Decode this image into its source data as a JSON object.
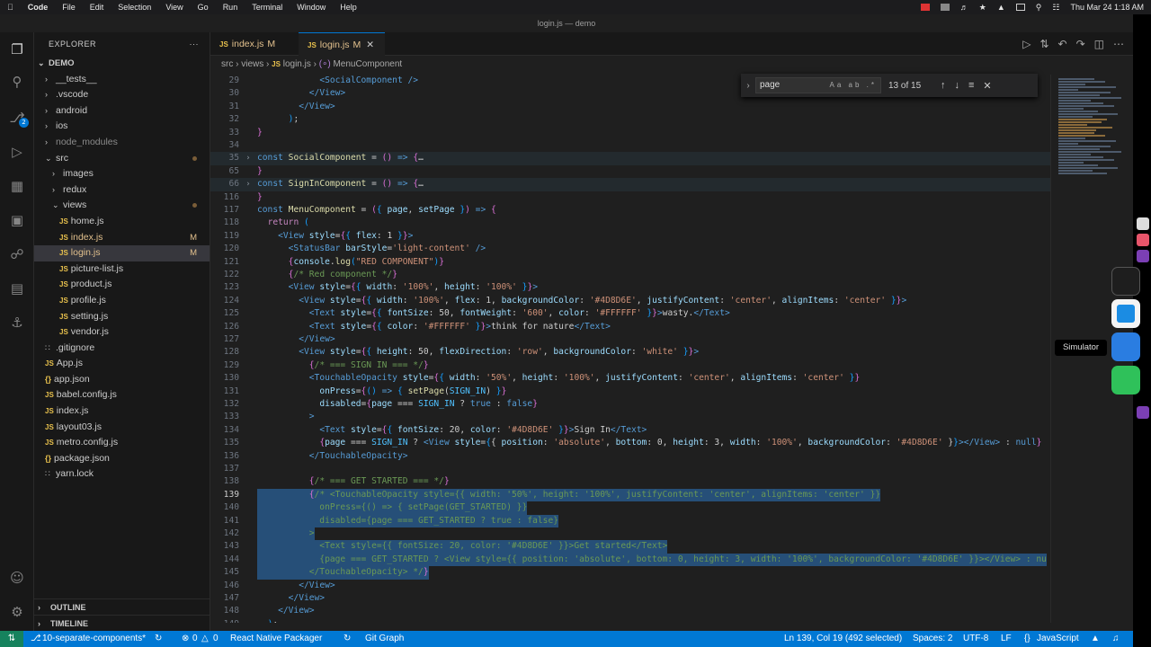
{
  "menubar": {
    "app": "Code",
    "items": [
      "File",
      "Edit",
      "Selection",
      "View",
      "Go",
      "Run",
      "Terminal",
      "Window",
      "Help"
    ],
    "clock": "Thu Mar 24  1:18 AM"
  },
  "window_title": "login.js — demo",
  "explorer": {
    "title": "EXPLORER",
    "more": "···",
    "root": "DEMO",
    "tree": [
      {
        "label": "__tests__",
        "kind": "folder",
        "depth": 1,
        "open": false
      },
      {
        "label": ".vscode",
        "kind": "folder",
        "depth": 1,
        "open": false
      },
      {
        "label": "android",
        "kind": "folder",
        "depth": 1,
        "open": false
      },
      {
        "label": "ios",
        "kind": "folder",
        "depth": 1,
        "open": false
      },
      {
        "label": "node_modules",
        "kind": "folder",
        "depth": 1,
        "open": false,
        "dim": true
      },
      {
        "label": "src",
        "kind": "folder",
        "depth": 1,
        "open": true,
        "mod": true
      },
      {
        "label": "images",
        "kind": "folder",
        "depth": 2,
        "open": false
      },
      {
        "label": "redux",
        "kind": "folder",
        "depth": 2,
        "open": false
      },
      {
        "label": "views",
        "kind": "folder",
        "depth": 2,
        "open": true,
        "mod": true
      },
      {
        "label": "home.js",
        "kind": "js",
        "depth": 3
      },
      {
        "label": "index.js",
        "kind": "js",
        "depth": 3,
        "mark": "M"
      },
      {
        "label": "login.js",
        "kind": "js",
        "depth": 3,
        "mark": "M",
        "selected": true
      },
      {
        "label": "picture-list.js",
        "kind": "js",
        "depth": 3
      },
      {
        "label": "product.js",
        "kind": "js",
        "depth": 3
      },
      {
        "label": "profile.js",
        "kind": "js",
        "depth": 3
      },
      {
        "label": "setting.js",
        "kind": "js",
        "depth": 3
      },
      {
        "label": "vendor.js",
        "kind": "js",
        "depth": 3
      },
      {
        "label": ".gitignore",
        "kind": "other",
        "depth": 1
      },
      {
        "label": "App.js",
        "kind": "js",
        "depth": 1
      },
      {
        "label": "app.json",
        "kind": "json",
        "depth": 1
      },
      {
        "label": "babel.config.js",
        "kind": "js",
        "depth": 1
      },
      {
        "label": "index.js",
        "kind": "js",
        "depth": 1
      },
      {
        "label": "layout03.js",
        "kind": "js",
        "depth": 1
      },
      {
        "label": "metro.config.js",
        "kind": "js",
        "depth": 1
      },
      {
        "label": "package.json",
        "kind": "json",
        "depth": 1
      },
      {
        "label": "yarn.lock",
        "kind": "other",
        "depth": 1
      }
    ],
    "outline": "OUTLINE",
    "timeline": "TIMELINE"
  },
  "tabs": [
    {
      "label": "index.js",
      "mark": "M",
      "active": false
    },
    {
      "label": "login.js",
      "mark": "M",
      "active": true
    }
  ],
  "breadcrumb": [
    "src",
    "views",
    "login.js",
    "MenuComponent"
  ],
  "find": {
    "query": "page",
    "count": "13 of 15",
    "opts": "Aa ab .*"
  },
  "code": [
    {
      "n": "29",
      "h": "            <span class='tg'>&lt;SocialComponent</span> <span class='tg'>/&gt;</span>"
    },
    {
      "n": "30",
      "h": "          <span class='tg'>&lt;/View&gt;</span>"
    },
    {
      "n": "31",
      "h": "        <span class='tg'>&lt;/View&gt;</span>"
    },
    {
      "n": "32",
      "h": "      <span class='br3'>)</span>;"
    },
    {
      "n": "33",
      "h": "<span class='br2'>}</span>"
    },
    {
      "n": "34",
      "h": ""
    },
    {
      "n": "35",
      "h": "<span class='kw'>const</span> <span class='fn'>SocialComponent</span> = <span class='br2'>()</span> <span class='kw'>=&gt;</span> <span class='br2'>{</span><span class='pn'>…</span>",
      "fold": true
    },
    {
      "n": "65",
      "h": "<span class='br2'>}</span>"
    },
    {
      "n": "66",
      "h": "<span class='kw'>const</span> <span class='fn'>SignInComponent</span> = <span class='br2'>()</span> <span class='kw'>=&gt;</span> <span class='br2'>{</span><span class='pn'>…</span>",
      "fold": true
    },
    {
      "n": "116",
      "h": "<span class='br2'>}</span>"
    },
    {
      "n": "117",
      "h": "<span class='kw'>const</span> <span class='fn'>MenuComponent</span> = <span class='br2'>(</span><span class='br3'>{</span> <span class='vr'>page</span>, <span class='vr'>setPage</span> <span class='br3'>}</span><span class='br2'>)</span> <span class='kw'>=&gt;</span> <span class='br2'>{</span>"
    },
    {
      "n": "118",
      "h": "  <span class='kc'>return</span> <span class='br3'>(</span>"
    },
    {
      "n": "119",
      "h": "    <span class='tg'>&lt;View</span> <span class='at'>style</span>=<span class='br2'>{</span><span class='br3'>{</span> <span class='at'>flex</span>: <span class='pn'>1</span> <span class='br3'>}</span><span class='br2'>}</span><span class='tg'>&gt;</span>"
    },
    {
      "n": "120",
      "h": "      <span class='tg'>&lt;StatusBar</span> <span class='at'>barStyle</span>=<span class='st'>'light-content'</span> <span class='tg'>/&gt;</span>"
    },
    {
      "n": "121",
      "h": "      <span class='br2'>{</span><span class='vr'>console</span>.<span class='fn'>log</span><span class='br3'>(</span><span class='st'>\"RED COMPONENT\"</span><span class='br3'>)</span><span class='br2'>}</span>"
    },
    {
      "n": "122",
      "h": "      <span class='br2'>{</span><span class='cm'>/* Red component */</span><span class='br2'>}</span>"
    },
    {
      "n": "123",
      "h": "      <span class='tg'>&lt;View</span> <span class='at'>style</span>=<span class='br2'>{</span><span class='br3'>{</span> <span class='at'>width</span>: <span class='st'>'100%'</span>, <span class='at'>height</span>: <span class='st'>'100%'</span> <span class='br3'>}</span><span class='br2'>}</span><span class='tg'>&gt;</span>"
    },
    {
      "n": "124",
      "h": "        <span class='tg'>&lt;View</span> <span class='at'>style</span>=<span class='br2'>{</span><span class='br3'>{</span> <span class='at'>width</span>: <span class='st'>'100%'</span>, <span class='at'>flex</span>: 1, <span class='at'>backgroundColor</span>: <span class='st'>'#4D8D6E'</span>, <span class='at'>justifyContent</span>: <span class='st'>'center'</span>, <span class='at'>alignItems</span>: <span class='st'>'center'</span> <span class='br3'>}</span><span class='br2'>}</span><span class='tg'>&gt;</span>"
    },
    {
      "n": "125",
      "h": "          <span class='tg'>&lt;Text</span> <span class='at'>style</span>=<span class='br2'>{</span><span class='br3'>{</span> <span class='at'>fontSize</span>: 50, <span class='at'>fontWeight</span>: <span class='st'>'600'</span>, <span class='at'>color</span>: <span class='st'>'#FFFFFF'</span> <span class='br3'>}</span><span class='br2'>}</span><span class='tg'>&gt;</span>wasty.<span class='tg'>&lt;/Text&gt;</span>"
    },
    {
      "n": "126",
      "h": "          <span class='tg'>&lt;Text</span> <span class='at'>style</span>=<span class='br2'>{</span><span class='br3'>{</span> <span class='at'>color</span>: <span class='st'>'#FFFFFF'</span> <span class='br3'>}</span><span class='br2'>}</span><span class='tg'>&gt;</span>think for nature<span class='tg'>&lt;/Text&gt;</span>"
    },
    {
      "n": "127",
      "h": "        <span class='tg'>&lt;/View&gt;</span>"
    },
    {
      "n": "128",
      "h": "        <span class='tg'>&lt;View</span> <span class='at'>style</span>=<span class='br2'>{</span><span class='br3'>{</span> <span class='at'>height</span>: 50, <span class='at'>flexDirection</span>: <span class='st'>'row'</span>, <span class='at'>backgroundColor</span>: <span class='st'>'white'</span> <span class='br3'>}</span><span class='br2'>}</span><span class='tg'>&gt;</span>"
    },
    {
      "n": "129",
      "h": "          <span class='br2'>{</span><span class='cm'>/* === SIGN IN === */</span><span class='br2'>}</span>"
    },
    {
      "n": "130",
      "h": "          <span class='tg'>&lt;TouchableOpacity</span> <span class='at'>style</span>=<span class='br2'>{</span><span class='br3'>{</span> <span class='at'>width</span>: <span class='st'>'50%'</span>, <span class='at'>height</span>: <span class='st'>'100%'</span>, <span class='at'>justifyContent</span>: <span class='st'>'center'</span>, <span class='at'>alignItems</span>: <span class='st'>'center'</span> <span class='br3'>}</span><span class='br2'>}</span>"
    },
    {
      "n": "131",
      "h": "            <span class='at'>onPress</span>=<span class='br2'>{</span><span class='br3'>()</span> <span class='kw'>=&gt;</span> <span class='br3'>{</span> <span class='fn'>setPage</span>(<span class='cn'>SIGN_IN</span>) <span class='br3'>}</span><span class='br2'>}</span>"
    },
    {
      "n": "132",
      "h": "            <span class='at'>disabled</span>=<span class='br2'>{</span><span class='vr'>page</span> === <span class='cn'>SIGN_IN</span> ? <span class='kw'>true</span> : <span class='kw'>false</span><span class='br2'>}</span>"
    },
    {
      "n": "133",
      "h": "          <span class='tg'>&gt;</span>"
    },
    {
      "n": "134",
      "h": "            <span class='tg'>&lt;Text</span> <span class='at'>style</span>=<span class='br2'>{</span><span class='br3'>{</span> <span class='at'>fontSize</span>: 20, <span class='at'>color</span>: <span class='st'>'#4D8D6E'</span> <span class='br3'>}</span><span class='br2'>}</span><span class='tg'>&gt;</span>Sign In<span class='tg'>&lt;/Text&gt;</span>"
    },
    {
      "n": "135",
      "h": "            <span class='br2'>{</span><span class='vr'>page</span> === <span class='cn'>SIGN_IN</span> ? <span class='tg'>&lt;View</span> <span class='at'>style</span>=<span class='br3'>{</span>{ <span class='at'>position</span>: <span class='st'>'absolute'</span>, <span class='at'>bottom</span>: 0, <span class='at'>height</span>: 3, <span class='at'>width</span>: <span class='st'>'100%'</span>, <span class='at'>backgroundColor</span>: <span class='st'>'#4D8D6E'</span> }<span class='br3'>}</span><span class='tg'>&gt;&lt;/View&gt;</span> : <span class='kw'>null</span><span class='br2'>}</span>"
    },
    {
      "n": "136",
      "h": "          <span class='tg'>&lt;/TouchableOpacity&gt;</span>"
    },
    {
      "n": "137",
      "h": ""
    },
    {
      "n": "138",
      "h": "          <span class='br2'>{</span><span class='cm'>/* === GET STARTED === */</span><span class='br2'>}</span>"
    },
    {
      "n": "139",
      "h": "          <span class='br2'>{</span><span class='cm'>/* &lt;TouchableOpacity style={{ width: '50%', height: '100%', justifyContent: 'center', alignItems: 'center' }}</span>",
      "sel": true,
      "cur": true
    },
    {
      "n": "140",
      "h": "<span class='cm'>            onPress={() =&gt; { setPage(GET_STARTED) }}</span>",
      "sel": true
    },
    {
      "n": "141",
      "h": "<span class='cm'>            disabled={page === GET_STARTED ? true : false}</span>",
      "sel": true
    },
    {
      "n": "142",
      "h": "<span class='cm'>          &gt;</span>",
      "sel": true
    },
    {
      "n": "143",
      "h": "<span class='cm'>            &lt;Text style={{ fontSize: 20, color: '#4D8D6E' }}&gt;Get started&lt;/Text&gt;</span>",
      "sel": true
    },
    {
      "n": "144",
      "h": "<span class='cm'>            {page === GET_STARTED ? &lt;View style={{ position: 'absolute', bottom: 0, height: 3, width: '100%', backgroundColor: '#4D8D6E' }}&gt;&lt;/View&gt; : nu</span>",
      "sel": true
    },
    {
      "n": "145",
      "h": "<span class='cm'>          &lt;/TouchableOpacity&gt; */</span><span class='br2'>}</span>",
      "sel": true
    },
    {
      "n": "146",
      "h": "        <span class='tg'>&lt;/View&gt;</span>"
    },
    {
      "n": "147",
      "h": "      <span class='tg'>&lt;/View&gt;</span>"
    },
    {
      "n": "148",
      "h": "    <span class='tg'>&lt;/View&gt;</span>"
    },
    {
      "n": "149",
      "h": "  <span class='br3'>)</span>;"
    }
  ],
  "status": {
    "branch": "10-separate-components*",
    "problems": "0",
    "warnings": "0",
    "packager": "React Native Packager",
    "graph": "Git Graph",
    "cursor": "Ln 139, Col 19 (492 selected)",
    "spaces": "Spaces: 2",
    "encoding": "UTF-8",
    "eol": "LF",
    "language": "JavaScript"
  },
  "tooltip": "Simulator",
  "colors": {
    "accent": "#0078d4",
    "status": "#0078d4",
    "selection": "#264f78"
  }
}
